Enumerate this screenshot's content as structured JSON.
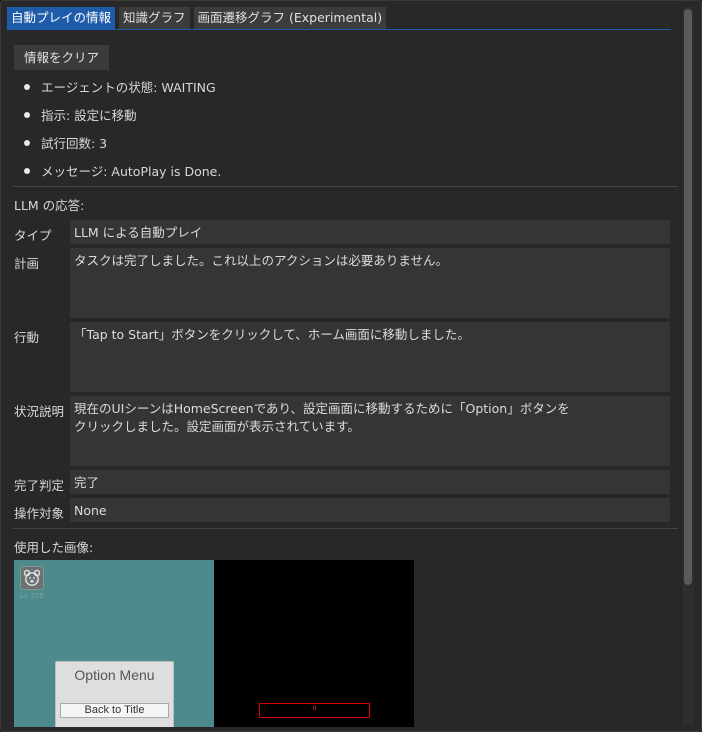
{
  "tabs": [
    {
      "label": "自動プレイの情報",
      "active": true
    },
    {
      "label": "知識グラフ",
      "active": false
    },
    {
      "label": "画面遷移グラフ (Experimental)",
      "active": false
    }
  ],
  "clear_button": "情報をクリア",
  "status": [
    "エージェントの状態: WAITING",
    "指示: 設定に移動",
    "試行回数: 3",
    "メッセージ: AutoPlay is Done."
  ],
  "llm_response_label": "LLM の応答:",
  "fields": {
    "type": {
      "label": "タイプ",
      "value": "LLM による自動プレイ"
    },
    "plan": {
      "label": "計画",
      "value": "タスクは完了しました。これ以上のアクションは必要ありません。"
    },
    "action": {
      "label": "行動",
      "value": "「Tap to Start」ボタンをクリックして、ホーム画面に移動しました。"
    },
    "situation": {
      "label": "状況説明",
      "value": "現在のUIシーンはHomeScreenであり、設定画面に移動するために「Option」ボタンを\nクリックしました。設定画面が表示されています。"
    },
    "completion": {
      "label": "完了判定",
      "value": "完了"
    },
    "target": {
      "label": "操作対象",
      "value": "None"
    }
  },
  "used_image_label": "使用した画像:",
  "screenshot": {
    "level_text": "Lv 255",
    "option_menu_title": "Option Menu",
    "back_button": "Back to Title",
    "red_box_text": "0"
  }
}
